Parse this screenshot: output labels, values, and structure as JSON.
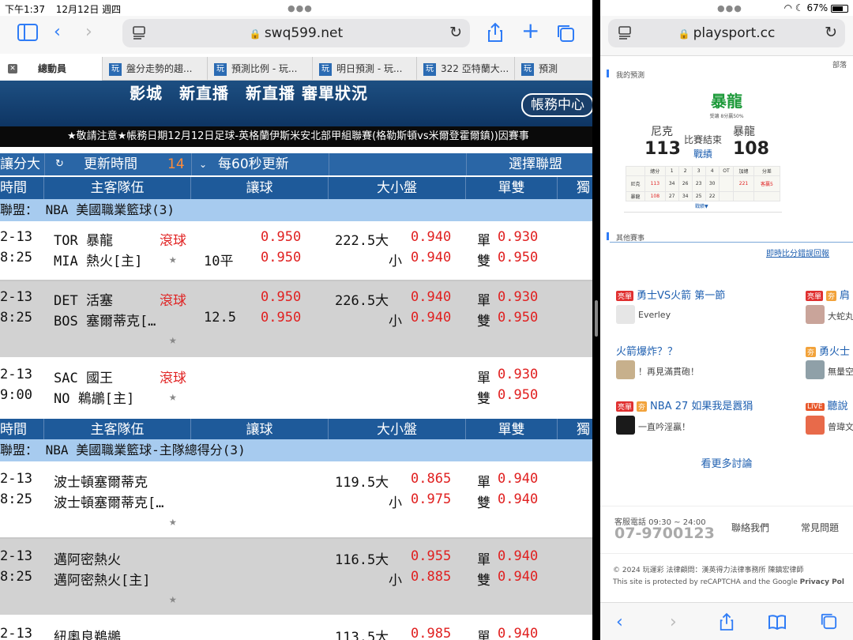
{
  "status": {
    "time": "下午1:37",
    "date": "12月12日 週四",
    "battery": "67%"
  },
  "left": {
    "url": "swq599.net",
    "tabs": [
      {
        "label": "總動員"
      },
      {
        "label": "盤分走勢的趨..."
      },
      {
        "label": "預測比例 - 玩..."
      },
      {
        "label": "明日預測 - 玩..."
      },
      {
        "label": "322 亞特蘭大..."
      },
      {
        "label": "預測"
      }
    ],
    "favicon_text": "玩",
    "banner_title": "影城　新直播　新直播 審單狀況",
    "account_button": "帳務中心",
    "ticker": "★敬請注意★帳務日期12月12日足球-英格蘭伊斯米安北部甲組聯賽(格勒斯頓vs米爾登霍爾鎮))因賽事",
    "controls": {
      "left_label": "讓分大",
      "refresh_label": "更新時間",
      "refresh_count": "14",
      "interval": "每60秒更新",
      "select_league": "選擇聯盟"
    },
    "headers": [
      "時間",
      "主客隊伍",
      "讓球",
      "大小盤",
      "單雙",
      "獨"
    ],
    "sections": [
      {
        "league": "聯盟： NBA 美國職業籃球(3)",
        "rows": [
          {
            "date": "2-13",
            "time": "8:25",
            "team1": "TOR 暴龍",
            "team2": "MIA 熱火[主]",
            "live": "滾球",
            "handicap": "10平",
            "h1": "0.950",
            "h2": "0.950",
            "total": "222.5大",
            "big": "0.940",
            "small_label": "小",
            "small": "0.940",
            "odd_label": "單",
            "odd": "0.930",
            "even_label": "雙",
            "even": "0.950"
          },
          {
            "date": "2-13",
            "time": "8:25",
            "team1": "DET 活塞",
            "team2": "BOS 塞爾蒂克[…",
            "live": "滾球",
            "handicap": "12.5",
            "h1": "0.950",
            "h2": "0.950",
            "total": "226.5大",
            "big": "0.940",
            "small_label": "小",
            "small": "0.940",
            "odd_label": "單",
            "odd": "0.930",
            "even_label": "雙",
            "even": "0.950"
          },
          {
            "date": "2-13",
            "time": "9:00",
            "team1": "SAC 國王",
            "team2": "NO 鵜鶘[主]",
            "live": "滾球",
            "odd_label": "單",
            "odd": "0.930",
            "even_label": "雙",
            "even": "0.950"
          }
        ]
      },
      {
        "league": "聯盟： NBA 美國職業籃球-主隊總得分(3)",
        "rows": [
          {
            "date": "2-13",
            "time": "8:25",
            "team1": "波士頓塞爾蒂克",
            "team2": "波士頓塞爾蒂克[…",
            "total": "119.5大",
            "big": "0.865",
            "small_label": "小",
            "small": "0.975",
            "odd_label": "單",
            "odd": "0.940",
            "even_label": "雙",
            "even": "0.940"
          },
          {
            "date": "2-13",
            "time": "8:25",
            "team1": "邁阿密熱火",
            "team2": "邁阿密熱火[主]",
            "total": "116.5大",
            "big": "0.955",
            "small_label": "小",
            "small": "0.885",
            "odd_label": "單",
            "odd": "0.940",
            "even_label": "雙",
            "even": "0.940"
          },
          {
            "date": "2-13",
            "team1": "紐奧良鵜鶘",
            "total": "113.5大",
            "big": "0.985",
            "odd_label": "單",
            "odd": "0.940"
          }
        ]
      }
    ]
  },
  "right": {
    "url": "playsport.cc",
    "corner": "部落",
    "my_prediction": "我的預測",
    "predicted_team": "暴龍",
    "predicted_sub": "受讓 8分贏50%",
    "away_team": "尼克",
    "away_score": "113",
    "status": "比賽結束",
    "record_link": "戰績",
    "home_team": "暴龍",
    "home_score": "108",
    "table_header": [
      "總分",
      "1",
      "2",
      "3",
      "4",
      "OT",
      "加總",
      "分差"
    ],
    "table_rows": [
      [
        "尼克",
        "113",
        "34",
        "26",
        "23",
        "30",
        "",
        "221",
        "客贏5"
      ],
      [
        "暴龍",
        "108",
        "27",
        "34",
        "25",
        "22",
        "",
        "",
        ""
      ]
    ],
    "expand": "戰績▼",
    "other_games": "其他賽事",
    "report_link": "即時比分錯誤回報",
    "posts": [
      {
        "tags": [
          "亮單"
        ],
        "title": "勇士VS火箭 第一節",
        "user": "Everley"
      },
      {
        "tags": [
          "亮單",
          "夯"
        ],
        "title": "肩",
        "user": "大蛇丸"
      },
      {
        "tags": [],
        "title": "火箭爆炸？？",
        "user": "！再見滿貫砲！"
      },
      {
        "tags": [
          "夯"
        ],
        "title": "勇火士",
        "user": "無量空"
      },
      {
        "tags": [
          "亮單",
          "夯"
        ],
        "title": "NBA 27 如果我是囂狷",
        "user": "一直吟淫贏！"
      },
      {
        "tags": [
          "LIVE"
        ],
        "title": "聽說",
        "user": "曾瑋文"
      }
    ],
    "more": "看更多討論",
    "hotline_label": "客服電話 09:30 ~ 24:00",
    "hotline": "07-9700123",
    "contact": "聯絡我們",
    "faq": "常見問題",
    "copyright": "© 2024 玩運彩 法律顧問：漢英得力法律事務所 陳鎮宏律師",
    "recaptcha": "This site is protected by reCAPTCHA and the Google ",
    "privacy": "Privacy Pol"
  },
  "colors": {
    "accent": "#2f7cf6",
    "header_blue": "#1e5a9a",
    "league_bg": "#a7cbef",
    "odds_red": "#e02020",
    "team_green": "#1d9a3a"
  }
}
